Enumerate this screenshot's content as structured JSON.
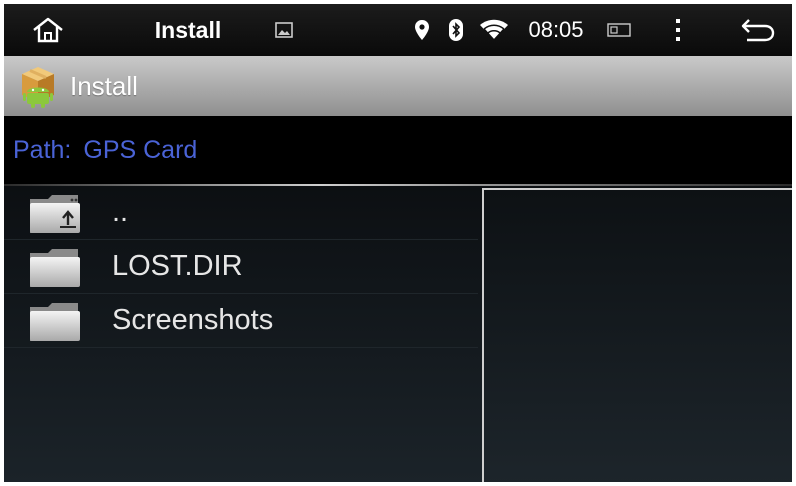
{
  "statusbar": {
    "title": "Install",
    "time": "08:05",
    "icons": [
      "home-icon",
      "gallery-icon",
      "location-icon",
      "bluetooth-icon",
      "wifi-icon",
      "battery-icon",
      "overflow-menu-icon",
      "back-icon"
    ]
  },
  "titlebar": {
    "title": "Install",
    "icon": "android-package-icon"
  },
  "path": {
    "label": "Path:",
    "value": "GPS Card"
  },
  "files": [
    {
      "name": "..",
      "icon": "folder-up-icon"
    },
    {
      "name": "LOST.DIR",
      "icon": "folder-icon"
    },
    {
      "name": "Screenshots",
      "icon": "folder-icon"
    }
  ],
  "colors": {
    "path_text": "#4a63d6",
    "titlebar": "#b0b0b0",
    "statusbar": "#111111"
  }
}
